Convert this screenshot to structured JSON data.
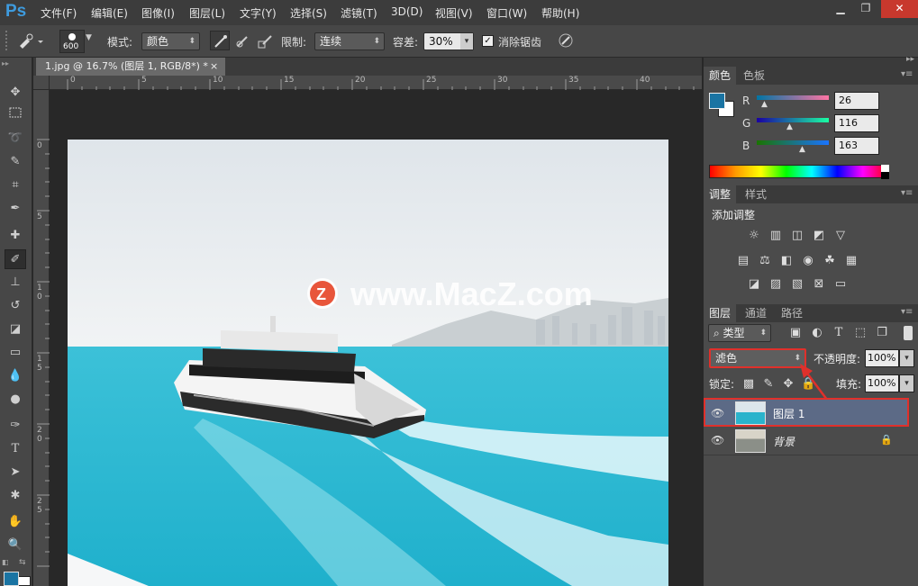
{
  "app": {
    "logo": "Ps"
  },
  "menu": [
    "文件(F)",
    "编辑(E)",
    "图像(I)",
    "图层(L)",
    "文字(Y)",
    "选择(S)",
    "滤镜(T)",
    "3D(D)",
    "视图(V)",
    "窗口(W)",
    "帮助(H)"
  ],
  "window_controls": {
    "minimize": "▁",
    "restore": "❐",
    "close": "✕"
  },
  "options": {
    "brush_size": "600",
    "mode_label": "模式:",
    "mode_value": "颜色",
    "limit_label": "限制:",
    "limit_value": "连续",
    "tolerance_label": "容差:",
    "tolerance_value": "30%",
    "antialias_label": "消除锯齿",
    "antialias_checked": true
  },
  "document": {
    "tab_title": "1.jpg @ 16.7% (图层 1, RGB/8*) *",
    "close": "×"
  },
  "ruler": {
    "top": [
      "0",
      "5",
      "10",
      "15",
      "20",
      "25",
      "30",
      "35",
      "40"
    ],
    "left": [
      "0",
      "5",
      "1 0",
      "1 5",
      "2 0",
      "2 5"
    ]
  },
  "watermark": {
    "badge": "Z",
    "text": "www.MacZ.com"
  },
  "color_panel": {
    "tabs": [
      "颜色",
      "色板"
    ],
    "r_label": "R",
    "g_label": "G",
    "b_label": "B",
    "r": "26",
    "g": "116",
    "b": "163",
    "foreground": "#1a74a3"
  },
  "adjust_panel": {
    "tabs": [
      "调整",
      "样式"
    ],
    "title": "添加调整"
  },
  "layers_panel": {
    "tabs": [
      "图层",
      "通道",
      "路径"
    ],
    "filter_kind": "类型",
    "blend_mode": "滤色",
    "opacity_label": "不透明度:",
    "opacity": "100%",
    "lock_label": "锁定:",
    "fill_label": "填充:",
    "fill": "100%",
    "layers": [
      {
        "name": "图层 1",
        "selected": true
      },
      {
        "name": "背景",
        "selected": false
      }
    ]
  },
  "colors": {
    "accent": "#3e9bde",
    "highlight": "#e0302b"
  }
}
